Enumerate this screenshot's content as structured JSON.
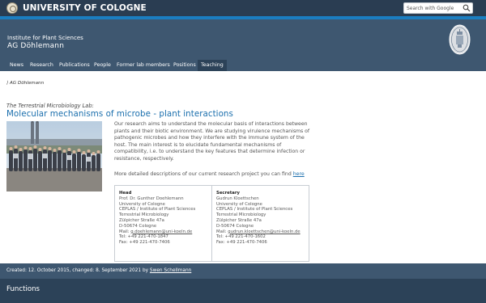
{
  "topbar": {
    "university_name": "UNIVERSITY OF COLOGNE",
    "search_placeholder": "Search with Google"
  },
  "header": {
    "institute": "Institute for Plant Sciences",
    "group": "AG Döhlemann"
  },
  "nav": {
    "items": [
      {
        "label": "News"
      },
      {
        "label": "Research"
      },
      {
        "label": "Publications"
      },
      {
        "label": "People"
      },
      {
        "label": "Former lab members"
      },
      {
        "label": "Positions"
      },
      {
        "label": "Teaching"
      }
    ]
  },
  "breadcrumb": {
    "marker": "⟩",
    "current": "AG Döhlemann"
  },
  "main": {
    "kicker": "The Terrestrial Microbiology Lab:",
    "title": "Molecular mechanisms of microbe - plant interactions",
    "intro": "Our research aims to understand the molecular basis of interactions between plants and their biotic environment. We are studying virulence mechanisms of pathogenic microbes and how they interfere with the immune system of the host. The main interest is to elucidate fundamental mechanisms of compatibility, i.e. to understand the key features that determine infection or resistance, respectively.",
    "more_text": "More detailed descriptions of our current research project you can find ",
    "more_link": "here"
  },
  "contacts": {
    "head": {
      "role": "Head",
      "name": "Prof. Dr. Gunther Doehlemann",
      "org": "University of Cologne",
      "inst": "CEPLAS / Institute of Plant Sciences",
      "lab": "Terrestrial Microbiology",
      "street": "Zülpicher Straße 47a",
      "city": "D-50674 Cologne",
      "mail_label": "Mail: ",
      "mail": "g.doehlemann@uni-koeln.de",
      "tel": "Tel: +49 221-470-1847",
      "fax": "Fax: +49 221-470-7406"
    },
    "secretary": {
      "role": "Secretary",
      "name": "Gudrun Kloettschen",
      "org": "University of Cologne",
      "inst": "CEPLAS / Institute of Plant Sciences",
      "lab": "Terrestrial Microbiology",
      "street": "Zülpicher Straße 47a",
      "city": "D-50674 Cologne",
      "mail_label": "Mail: ",
      "mail": "gudrun.kloettschen@uni-koeln.de",
      "tel": "Tel: +49 221-470-1602",
      "fax": "Fax: +49 221-470-7406"
    }
  },
  "meta": {
    "text": "Created: 12. October 2015, changed:  8. September 2021 by ",
    "author": "Swen Schellmann"
  },
  "functions": {
    "title": "Functions"
  },
  "colors": {
    "topbar": "#2a3d52",
    "stripe": "#1b7ec1",
    "header": "#3e5770",
    "link": "#1b6fad"
  },
  "icons": {
    "search": "magnifier-icon",
    "seal": "university-seal-icon",
    "logo": "university-logo-icon"
  }
}
